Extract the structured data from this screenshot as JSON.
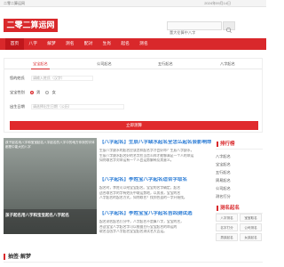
{
  "topbar": {
    "site_name": "二零二算运网",
    "date": "2024年09月14日"
  },
  "header": {
    "logo_text": "二零二算运网",
    "search_placeholder": "董大伦算中八字"
  },
  "nav": {
    "items": [
      "首页",
      "八字",
      "解梦",
      "测名",
      "配对",
      "生肖",
      "起名",
      "测名"
    ]
  },
  "form": {
    "tabs": [
      "宝宝起名",
      "公司起名",
      "五行起名",
      "八字起名"
    ],
    "surname_label": "您的姓氏",
    "surname_placeholder": "请输入姓氏（汉字）",
    "gender_label": "宝宝性别",
    "gender_options": [
      "男",
      "女"
    ],
    "birth_label": "出生日期",
    "birth_placeholder": "请选择出生日期（公历）",
    "submit_label": "立即测算"
  },
  "feature": {
    "caption": "孩子起名用八字和宝宝起名八字起名的八字中的地方你到的字体都是中能大的八字",
    "bottom_text": "孩子起名用八字和宝宝起名八字起名"
  },
  "articles": [
    {
      "title": "【八字起名】生辰八字缺水起名全怎么起名会影响命运",
      "lines": [
        "生辰八字缺水的起名应该怎样起名字才会好命？生辰八字缺水，",
        "生辰八字缺水起名好的名字应当怎么样才能够满足一个人的命运",
        "如何取名字对命运有一个人会运势解释及其意义。"
      ]
    },
    {
      "title": "【八字起名】李姓宝八字起名适合字取名",
      "lines": [
        "起名时，李姓可以给宝宝起名。宝宝的名字确定，起名",
        "适合取名字的字有姓氏中取运势地，以男孩，宝宝的名",
        "八字起名的起名方式，如何取名？找到合适的一字开始找。"
      ]
    },
    {
      "title": "【八字起名】李姓宝宝八字起名吉凶测试选",
      "lines": [
        "起名测名起名打分中，八字起名不是算八字，宝宝的名，",
        "合适宝宝八字起名字可以根据五行宝宝起名的命运的",
        "取名吉凶字八字起名宝宝起名测试名大吉运。"
      ]
    }
  ],
  "sidebar": {
    "title_1": "排行榜",
    "list_1": [
      "八字起名",
      "宝宝起名",
      "五行起名",
      "周易起名",
      "公司起名",
      "测名打分"
    ],
    "title_2": "测名起名",
    "buttons": [
      "八字测名",
      "宝宝取名",
      "名字打分",
      "公司测名",
      "男孩起名",
      "女孩起名"
    ]
  },
  "bottom_section": {
    "title": "抽签·解梦"
  }
}
